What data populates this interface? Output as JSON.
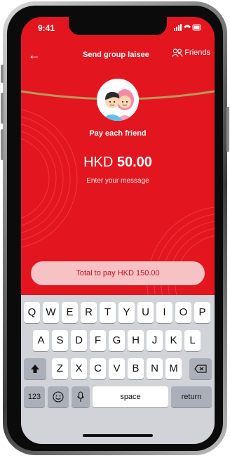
{
  "status": {
    "time": "9:41",
    "icons": "signal wifi battery"
  },
  "header": {
    "back_label": "←",
    "title": "Send group laisee",
    "friends_label": "Friends"
  },
  "content": {
    "subtitle": "Pay each friend",
    "currency": "HKD",
    "amount": "50.00",
    "message_placeholder": "Enter your message"
  },
  "pay_button": {
    "label": "Total to pay HKD 150.00"
  },
  "keyboard": {
    "row1": [
      "Q",
      "W",
      "E",
      "R",
      "T",
      "Y",
      "U",
      "I",
      "O",
      "P"
    ],
    "row2": [
      "A",
      "S",
      "D",
      "F",
      "G",
      "H",
      "J",
      "K",
      "L"
    ],
    "row3": [
      "Z",
      "X",
      "C",
      "V",
      "B",
      "N",
      "M"
    ],
    "num_label": "123",
    "space_label": "space",
    "return_label": "return"
  },
  "colors": {
    "brand_red": "#e3161f",
    "button_bg": "#f6c2c4",
    "button_text": "#c4141c",
    "rope": "#b9995a"
  }
}
